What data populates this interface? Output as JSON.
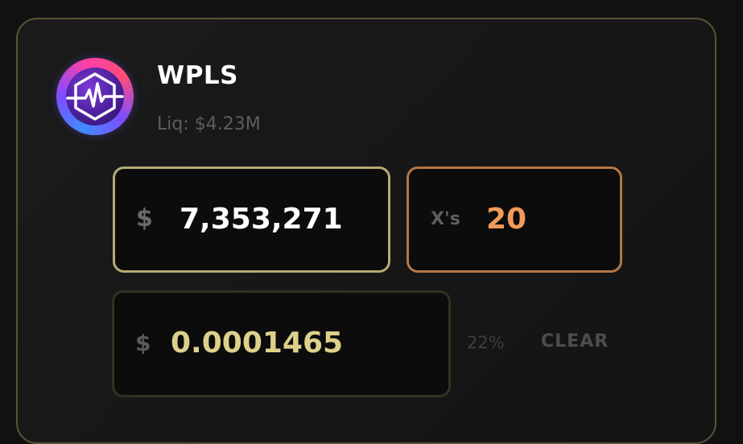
{
  "token": {
    "name": "WPLS",
    "liquidity": "Liq: $4.23M",
    "logo_icon": "pulse-heartbeat-icon"
  },
  "market_cap_input": {
    "prefix": "$",
    "value": "7,353,271"
  },
  "multiplier_input": {
    "prefix": "X's",
    "value": "20"
  },
  "price_input": {
    "prefix": "$",
    "value": "0.0001465"
  },
  "percent": "22%",
  "clear_label": "CLEAR",
  "colors": {
    "card_border": "#5b5237",
    "market_cap_border": "#b6ab74",
    "multiplier_border": "#b57743",
    "multiplier_value": "#f09a5c",
    "price_value": "#ddd08a"
  }
}
